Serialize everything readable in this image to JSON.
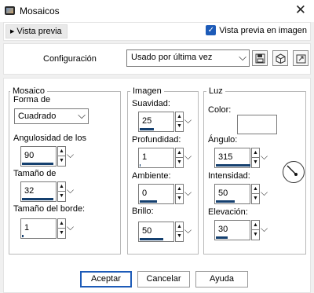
{
  "window": {
    "title": "Mosaicos",
    "close_glyph": "✕"
  },
  "preview": {
    "toggle_label": "Vista previa",
    "checkbox_label": "Vista previa en imagen",
    "checkbox_checked": true
  },
  "config": {
    "label": "Configuración",
    "preset_value": "Usado por última vez"
  },
  "mosaico": {
    "title": "Mosaico",
    "forma_label": "Forma de",
    "forma_value": "Cuadrado",
    "angulosidad_label": "Angulosidad de los",
    "angulosidad_value": "90",
    "tamano_label": "Tamaño de",
    "tamano_value": "32",
    "borde_label": "Tamaño del borde:",
    "borde_value": "1"
  },
  "imagen": {
    "title": "Imagen",
    "suavidad_label": "Suavidad:",
    "suavidad_value": "25",
    "profundidad_label": "Profundidad:",
    "profundidad_value": "1",
    "ambiente_label": "Ambiente:",
    "ambiente_value": "0",
    "brillo_label": "Brillo:",
    "brillo_value": "50"
  },
  "luz": {
    "title": "Luz",
    "color_label": "Color:",
    "color_value": "#ffffff",
    "angulo_label": "Ángulo:",
    "angulo_value": "315",
    "intensidad_label": "Intensidad:",
    "intensidad_value": "50",
    "elevacion_label": "Elevación:",
    "elevacion_value": "30"
  },
  "buttons": {
    "ok": "Aceptar",
    "cancel": "Cancelar",
    "help": "Ayuda"
  },
  "colors": {
    "accent": "#1d5bb8",
    "slider_fill": "#15406f"
  }
}
